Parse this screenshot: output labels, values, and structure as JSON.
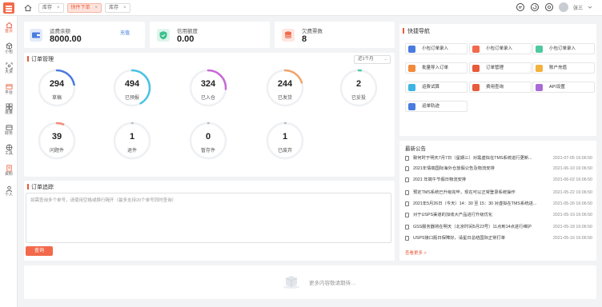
{
  "topbar": {
    "tabs": [
      {
        "label": "库存",
        "close": "×"
      },
      {
        "label": "快件下单",
        "close": "×"
      },
      {
        "label": "库存",
        "close": "×"
      }
    ],
    "username": "张三"
  },
  "sidebar": {
    "items": [
      {
        "label": "首页",
        "icon": "home-icon"
      },
      {
        "label": "小包",
        "icon": "package-icon"
      },
      {
        "label": "大货",
        "icon": "cargo-icon"
      },
      {
        "label": "平台",
        "icon": "platform-icon"
      },
      {
        "label": "批量",
        "icon": "batch-icon"
      },
      {
        "label": "财务",
        "icon": "finance-icon"
      },
      {
        "label": "工具",
        "icon": "tools-icon"
      },
      {
        "label": "资料",
        "icon": "docs-icon"
      },
      {
        "label": "个人",
        "icon": "user-icon"
      }
    ]
  },
  "stats": {
    "balance": {
      "label": "运费余额",
      "value": "8000.00",
      "link": "充值"
    },
    "credit": {
      "label": "信用额度",
      "value": "0.00"
    },
    "overdue": {
      "label": "欠费票数",
      "value": "8"
    }
  },
  "orders": {
    "title": "订单管理",
    "period": "近1个月",
    "rings": [
      {
        "value": "294",
        "label": "草稿",
        "color": "#4a7bdf",
        "progress": 0.22
      },
      {
        "value": "494",
        "label": "已预报",
        "color": "#4cc2e6",
        "progress": 0.42
      },
      {
        "value": "324",
        "label": "已入仓",
        "color": "#c86ad6",
        "progress": 0.26
      },
      {
        "value": "244",
        "label": "已发货",
        "color": "#f2a36b",
        "progress": 0.2
      },
      {
        "value": "2",
        "label": "已妥投",
        "color": "#4ec9a0",
        "progress": 0.02
      },
      {
        "value": "39",
        "label": "问题件",
        "color": "#f28b7b",
        "progress": 0.06
      },
      {
        "value": "1",
        "label": "退件",
        "color": "#bbbbbb",
        "progress": 0.0
      },
      {
        "value": "0",
        "label": "暂存件",
        "color": "#bbbbbb",
        "progress": 0.0
      },
      {
        "value": "1",
        "label": "已废弃",
        "color": "#bbbbbb",
        "progress": 0.0
      }
    ]
  },
  "tracking": {
    "title": "订单追踪",
    "placeholder": "如需查询多个单号，请使用空格或换行隔开（最多支持20个单号同时查询）",
    "button": "查询"
  },
  "quick": {
    "title": "快捷导航",
    "items": [
      {
        "label": "小包订单录入",
        "color": "#4a7bdf"
      },
      {
        "label": "小包订单录入",
        "color": "#f26a4b"
      },
      {
        "label": "小包订单录入",
        "color": "#4ec9a0"
      },
      {
        "label": "批量导入订单",
        "color": "#f28a3c"
      },
      {
        "label": "订单管理",
        "color": "#e85a3b"
      },
      {
        "label": "账户充值",
        "color": "#f2b23c"
      },
      {
        "label": "运费试算",
        "color": "#3cb4e6"
      },
      {
        "label": "费用查询",
        "color": "#e85a3b"
      },
      {
        "label": "API设置",
        "color": "#a86ad6"
      },
      {
        "label": "运单轨迹",
        "color": "#4a7bdf"
      }
    ]
  },
  "announcements": {
    "title": "最新公告",
    "items": [
      {
        "title": "致何时于明天7月7日（星期三）对需虚拟在TMS系统进行更新...",
        "date": "2021-07-05 16:06:50"
      },
      {
        "title": "2021年情端国际海外仓放假公告及物流安排",
        "date": "2021-06-10 16:06:50"
      },
      {
        "title": "2021 年端午节假日物流安排",
        "date": "2021-06-02 16:06:50"
      },
      {
        "title": "预定TMS系统已升级完毕，现在可以正常登录系统操作",
        "date": "2021-05-22 16:06:50"
      },
      {
        "title": "2021年5月26日（今天）14：30 至 15：30 对虚拟在TMS系统进...",
        "date": "2021-05-26 16:06:50"
      },
      {
        "title": "对于USPS渠道的加收大产品进行升级优化",
        "date": "2021-05-19 16:06:50"
      },
      {
        "title": "GSS服务器将在明天（北京时间5月23号）11点到14点进行维护",
        "date": "2021-05-18 16:06:50"
      },
      {
        "title": "USPS接口瓶日保障好，请星日总结国际正常打单",
        "date": "2021-05-16 16:06:50"
      }
    ],
    "more": "查看更多 >"
  },
  "footer": {
    "text": "更多内容敬请期待…"
  }
}
